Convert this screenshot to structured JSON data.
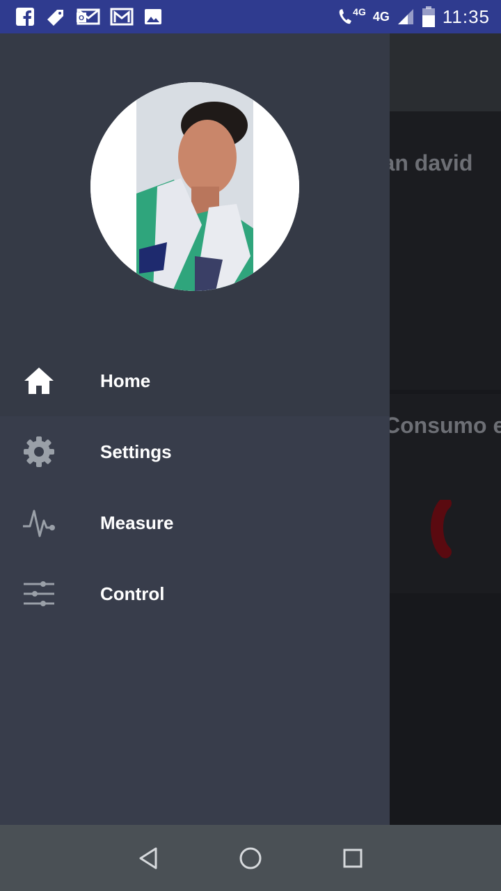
{
  "status_bar": {
    "notification_icons": [
      "facebook-icon",
      "tag-icon",
      "outlook-icon",
      "gmail-icon",
      "image-icon"
    ],
    "network_call": "4G",
    "network_data": "4G",
    "time": "11:35"
  },
  "background": {
    "user_name_partial": "uan david",
    "card_title_partial": "Consumo e"
  },
  "drawer": {
    "avatar_alt": "User profile photo",
    "menu": [
      {
        "label": "Home",
        "icon": "home-icon"
      },
      {
        "label": "Settings",
        "icon": "gear-icon"
      },
      {
        "label": "Measure",
        "icon": "pulse-icon"
      },
      {
        "label": "Control",
        "icon": "sliders-icon"
      }
    ]
  },
  "colors": {
    "status_bar": "#2f3b8f",
    "drawer": "#383d4b",
    "nav_bar": "#4a5055",
    "gauge_accent": "#5a0a10"
  }
}
